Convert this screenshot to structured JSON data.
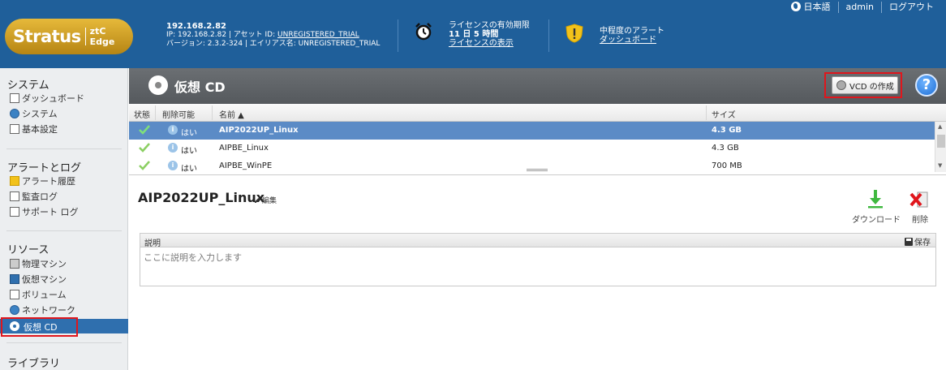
{
  "topnav": {
    "language": "日本語",
    "user": "admin",
    "logout": "ログアウト"
  },
  "logo": {
    "brand": "Stratus",
    "product": "ztC Edge"
  },
  "system": {
    "ip_title": "192.168.2.82",
    "line1_prefix": "IP: 192.168.2.82 | アセット ID: ",
    "asset_id": "UNREGISTERED_TRIAL",
    "line2": "バージョン: 2.3.2-324 | エイリアス名: UNREGISTERED_TRIAL"
  },
  "license": {
    "title": "ライセンスの有効期限",
    "remaining": "11 日 5 時間",
    "link": "ライセンスの表示"
  },
  "alert": {
    "title": "中程度のアラート",
    "link": "ダッシュボード"
  },
  "sidebar": {
    "system_title": "システム",
    "system_items": [
      "ダッシュボード",
      "システム",
      "基本設定"
    ],
    "alerts_title": "アラートとログ",
    "alerts_items": [
      "アラート履歴",
      "監査ログ",
      "サポート ログ"
    ],
    "resources_title": "リソース",
    "resources_items": [
      "物理マシン",
      "仮想マシン",
      "ボリューム",
      "ネットワーク"
    ],
    "active_item": "仮想 CD",
    "library_title": "ライブラリ"
  },
  "toolbar": {
    "title": "仮想 CD",
    "create_vcd": "VCD の作成",
    "help": "?"
  },
  "table": {
    "headers": {
      "status": "状態",
      "deletable": "削除可能",
      "name": "名前 ▲",
      "size": "サイズ"
    },
    "rows": [
      {
        "deletable": "はい",
        "name": "AIP2022UP_Linux",
        "size": "4.3 GB",
        "selected": true
      },
      {
        "deletable": "はい",
        "name": "AIPBE_Linux",
        "size": "4.3 GB",
        "selected": false
      },
      {
        "deletable": "はい",
        "name": "AIPBE_WinPE",
        "size": "700 MB",
        "selected": false
      }
    ]
  },
  "detail": {
    "title": "AIP2022UP_Linux",
    "edit": "編集",
    "download": "ダウンロード",
    "delete": "削除",
    "description_label": "説明",
    "save": "保存",
    "description_placeholder": "ここに説明を入力します"
  },
  "colors": {
    "header": "#1f5f9a",
    "active": "#2f6fae",
    "selected_row": "#5b8bc6",
    "highlight_box": "#e0161c"
  }
}
